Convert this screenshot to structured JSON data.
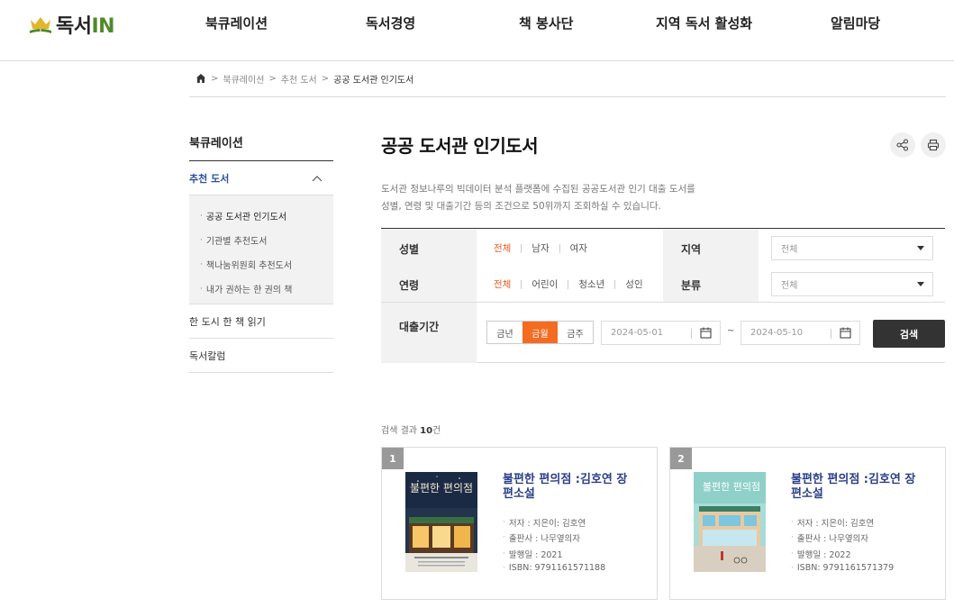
{
  "header": {
    "logo_text_main": "독서",
    "logo_text_accent": "IN",
    "nav": [
      "북큐레이션",
      "독서경영",
      "책 봉사단",
      "지역 독서 활성화",
      "알림마당"
    ]
  },
  "breadcrumb": {
    "items": [
      "북큐레이션",
      "추천 도서",
      "공공 도서관 인기도서"
    ]
  },
  "lnb": {
    "title": "북큐레이션",
    "active_item": "추천 도서",
    "sub_items": [
      "공공 도서관 인기도서",
      "기관별 추천도서",
      "책나눔위원회 추천도서",
      "내가 권하는 한 권의 책"
    ],
    "other_items": [
      "한 도시 한 책 읽기",
      "독서칼럼"
    ]
  },
  "main": {
    "title": "공공 도서관 인기도서",
    "desc_line1": "도서관 정보나루의 빅데이터 분석 플랫폼에 수집된 공공도서관 인기 대출 도서를",
    "desc_line2": "성별, 연령 및 대출기간 등의 조건으로 50위까지 조회하실 수 있습니다."
  },
  "filter": {
    "gender_label": "성별",
    "gender_options": [
      "전체",
      "남자",
      "여자"
    ],
    "age_label": "연령",
    "age_options": [
      "전체",
      "어린이",
      "청소년",
      "성인"
    ],
    "region_label": "지역",
    "region_value": "전체",
    "category_label": "분류",
    "category_value": "전체",
    "period_label": "대출기간",
    "period_options": [
      "금년",
      "금월",
      "금주"
    ],
    "date_from": "2024-05-01",
    "date_sep": "~",
    "date_to": "2024-05-10",
    "search_label": "검색",
    "accent_color": "#f36c21"
  },
  "results": {
    "count_prefix": "검색 결과",
    "count_value": "10",
    "count_suffix": "건",
    "books": [
      {
        "rank": "1",
        "title": "불편한 편의점 :김호연 장편소설",
        "author": "저자 : 지은이: 김호연",
        "publisher": "출판사 : 나무옆의자",
        "year": "발행일 : 2021",
        "isbn": "ISBN: 9791161571188",
        "cover_title": "불편한 편의점"
      },
      {
        "rank": "2",
        "title": "불편한 편의점 :김호연 장편소설",
        "author": "저자 : 지은이: 김호연",
        "publisher": "출판사 : 나무옆의자",
        "year": "발행일 : 2022",
        "isbn": "ISBN: 9791161571379",
        "cover_title": "불편한 편의점"
      }
    ]
  }
}
